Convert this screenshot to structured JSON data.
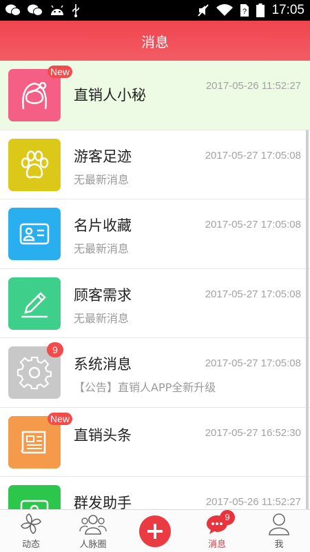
{
  "status_bar": {
    "time": "17:05",
    "icons": [
      "wechat-icon",
      "wechat-icon",
      "android-icon",
      "usb-icon",
      "mute-icon",
      "wifi-icon",
      "sim-icon",
      "battery-icon"
    ]
  },
  "header": {
    "title": "消息"
  },
  "messages": [
    {
      "title": "直销人小秘",
      "subtitle": "",
      "time": "2017-05-26 11:52:27",
      "badge": "New",
      "icon": "girl-face-icon",
      "color": "#f55f86",
      "highlighted": true
    },
    {
      "title": "游客足迹",
      "subtitle": "无最新消息",
      "time": "2017-05-27 17:05:08",
      "badge": "",
      "icon": "paw-icon",
      "color": "#dcc819"
    },
    {
      "title": "名片收藏",
      "subtitle": "无最新消息",
      "time": "2017-05-27 17:05:08",
      "badge": "",
      "icon": "id-card-icon",
      "color": "#29aef0"
    },
    {
      "title": "顾客需求",
      "subtitle": "无最新消息",
      "time": "2017-05-27 17:05:08",
      "badge": "",
      "icon": "pen-icon",
      "color": "#3ecf8a"
    },
    {
      "title": "系统消息",
      "subtitle": "【公告】直销人APP全新升级",
      "time": "2017-05-27 17:05:08",
      "badge": "9",
      "icon": "gear-icon",
      "color": "#c8c8c8"
    },
    {
      "title": "直销头条",
      "subtitle": "",
      "time": "2017-05-27 16:52:30",
      "badge": "New",
      "icon": "newspaper-icon",
      "color": "#f59a4a"
    },
    {
      "title": "群发助手",
      "subtitle": "",
      "time": "2017-05-26 11:52:27",
      "badge": "",
      "icon": "group-send-icon",
      "color": "#2cc64c"
    }
  ],
  "tabs": [
    {
      "label": "动态",
      "icon": "pinwheel-icon"
    },
    {
      "label": "人脉圈",
      "icon": "people-icon"
    },
    {
      "label": "",
      "icon": "plus-icon"
    },
    {
      "label": "消息",
      "icon": "chat-icon",
      "badge": "9",
      "active": true
    },
    {
      "label": "我",
      "icon": "user-icon"
    }
  ],
  "colors": {
    "accent": "#e8343c",
    "header": "#f0444f",
    "highlight_row": "#eefbe4"
  }
}
